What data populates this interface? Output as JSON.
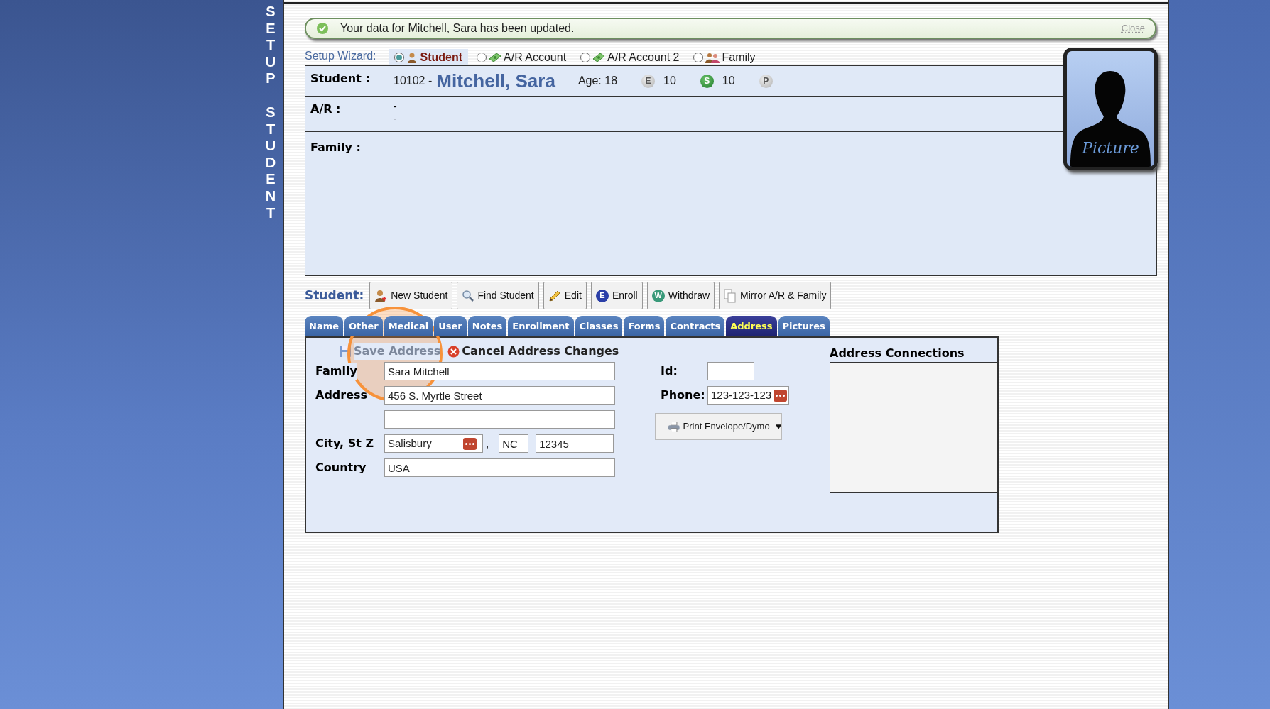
{
  "sidebar": {
    "words": [
      "SETUP",
      "STUDENT"
    ]
  },
  "notification": {
    "message": "Your data for Mitchell, Sara has been updated.",
    "close": "Close"
  },
  "setup_wizard": {
    "label": "Setup Wizard:",
    "options": [
      {
        "label": "Student",
        "kind": "student",
        "selected": true
      },
      {
        "label": "A/R Account",
        "kind": "money",
        "selected": false
      },
      {
        "label": "A/R Account 2",
        "kind": "money",
        "selected": false
      },
      {
        "label": "Family",
        "kind": "family",
        "selected": false
      }
    ]
  },
  "student": {
    "label": "Student :",
    "id": "10102 -",
    "name": "Mitchell, Sara",
    "age": "Age: 18",
    "badges": [
      {
        "letter": "E",
        "count": "10",
        "active": false
      },
      {
        "letter": "S",
        "count": "10",
        "active": true
      },
      {
        "letter": "P",
        "active": false
      }
    ]
  },
  "ar": {
    "label": "A/R :",
    "lines": [
      "-",
      "-"
    ]
  },
  "family": {
    "label": "Family :"
  },
  "picture_card": {
    "label": "Picture"
  },
  "toolbar": {
    "label": "Student:",
    "buttons": [
      {
        "label": "New Student",
        "kind": "add"
      },
      {
        "label": "Find Student",
        "kind": "find"
      },
      {
        "label": "Edit",
        "kind": "edit"
      },
      {
        "label": "Enroll",
        "kind": "letter",
        "letter": "E",
        "color": "#2b3fa8"
      },
      {
        "label": "Withdraw",
        "kind": "letter",
        "letter": "W",
        "color": "#3a9a7a"
      },
      {
        "label": "Mirror A/R & Family",
        "kind": "copy"
      }
    ]
  },
  "tabs": [
    {
      "label": "Name",
      "selected": false
    },
    {
      "label": "Other",
      "selected": false
    },
    {
      "label": "Medical",
      "selected": false
    },
    {
      "label": "User",
      "selected": false
    },
    {
      "label": "Notes",
      "selected": false
    },
    {
      "label": "Enrollment",
      "selected": false
    },
    {
      "label": "Classes",
      "selected": false
    },
    {
      "label": "Forms",
      "selected": false
    },
    {
      "label": "Contracts",
      "selected": false
    },
    {
      "label": "Address",
      "selected": true
    },
    {
      "label": "Pictures",
      "selected": false
    }
  ],
  "address_form": {
    "save": {
      "label": "Save Address",
      "disabled": true
    },
    "cancel": {
      "label": "Cancel Address Changes"
    },
    "family_label": "Family",
    "family_value": "Sara Mitchell",
    "address_label": "Address",
    "address_line1": "456 S. Myrtle Street",
    "city_label": "City, St Z",
    "city": "Salisbury",
    "separator": ",",
    "state": "NC",
    "zip": "12345",
    "country_label": "Country",
    "country": "USA",
    "id_label": "Id:",
    "phone_label": "Phone:",
    "phone": "123-123-123",
    "print_button": "Print Envelope/Dymo",
    "connections_title": "Address Connections"
  }
}
